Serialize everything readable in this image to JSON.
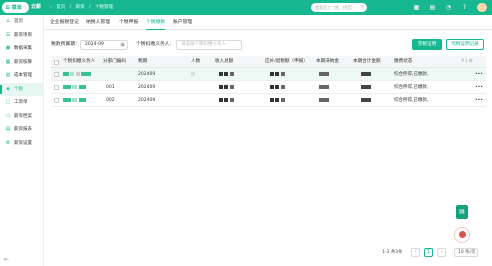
{
  "topbar": {
    "menu_icon": "list-icon",
    "menu_label": "菜单",
    "logo_text": "云薪",
    "breadcrumbs": [
      "首页",
      "薪资",
      "个税管理"
    ],
    "search_placeholder": "搜索员工（姓、拼音）",
    "icons": [
      "grid-icon",
      "clipboard-icon",
      "bell-icon",
      "help-icon",
      "settings-icon"
    ]
  },
  "sidebar": {
    "items": [
      {
        "label": "首页",
        "icon": "home-icon"
      },
      {
        "label": "薪资项目",
        "icon": "list-icon"
      },
      {
        "label": "数据采集",
        "icon": "database-icon"
      },
      {
        "label": "薪资核算",
        "icon": "calculator-icon"
      },
      {
        "label": "成本管理",
        "icon": "chart-icon"
      },
      {
        "label": "个税",
        "icon": "tax-icon",
        "active": true
      },
      {
        "label": "工资单",
        "icon": "document-icon"
      },
      {
        "label": "薪资档案",
        "icon": "folder-icon"
      },
      {
        "label": "薪资报表",
        "icon": "report-icon"
      },
      {
        "label": "薪资设置",
        "icon": "gear-icon"
      }
    ],
    "collapse_icon": "collapse-icon"
  },
  "tabs": [
    "企业报税登记",
    "纳税人管理",
    "个税申报",
    "个税缴款",
    "账户管理"
  ],
  "active_tab": 3,
  "filters": {
    "period_label": "税款所属期：",
    "period_value": "2024-09",
    "withholder_label": "个税扣缴义务人：",
    "withholder_placeholder": "请选择个税扣缴义务人"
  },
  "buttons": {
    "proof": "完税证明",
    "proof_record": "完税证明记录"
  },
  "table": {
    "columns": [
      "个税扣缴义务人",
      "分部门编码",
      "税期",
      "人数",
      "收入总额",
      "应补/退税额（申报）",
      "本期滞纳金",
      "本期合计金额",
      "缴费状态"
    ],
    "rows": [
      {
        "code": "",
        "period": "202409",
        "count": "",
        "status": "综合所得,已缴款,"
      },
      {
        "code": "001",
        "period": "202409",
        "count": "",
        "status": "综合所得,已缴款,"
      },
      {
        "code": "002",
        "period": "202409",
        "count": "",
        "status": "综合所得,已缴款,"
      }
    ],
    "row_action": "•••"
  },
  "pagination": {
    "summary": "1-3 共3条",
    "current_page": "1",
    "page_size": "10 条/页"
  },
  "colors": {
    "accent": "#17b890"
  }
}
